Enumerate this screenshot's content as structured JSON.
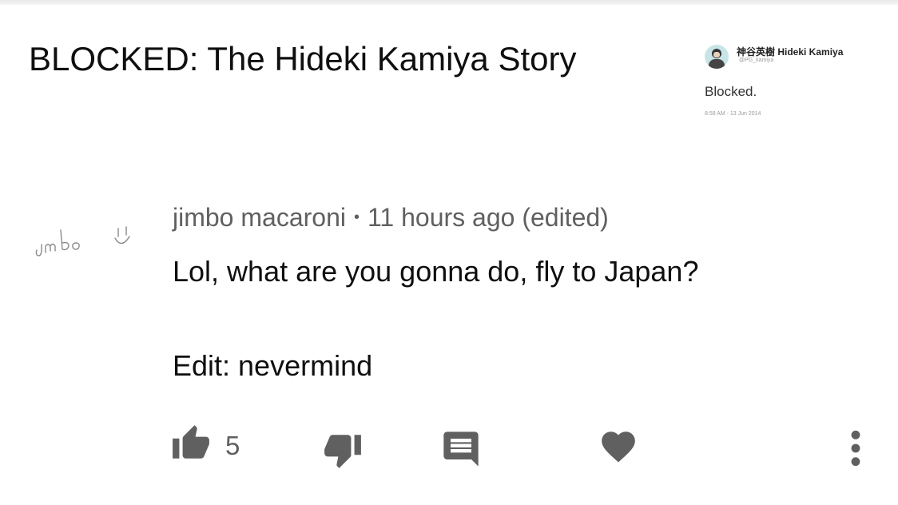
{
  "video": {
    "title": "BLOCKED: The Hideki Kamiya Story"
  },
  "tweet": {
    "display_name": "神谷英樹 Hideki Kamiya",
    "handle": "@PG_kamiya",
    "text": "Blocked.",
    "timestamp": "8:58 AM - 13 Jun 2014",
    "avatar_color": "#c7e4e6"
  },
  "comment": {
    "author_avatar_lettering": "jimbo :)",
    "author": "jimbo macaroni",
    "separator": "•",
    "time": "11 hours ago (edited)",
    "text": "Lol, what are you gonna do, fly to Japan?",
    "edit_note": "Edit: nevermind"
  },
  "actions": {
    "like_icon": "thumbs-up-icon",
    "like_count": "5",
    "dislike_icon": "thumbs-down-icon",
    "reply_icon": "comment-icon",
    "heart_icon": "heart-icon",
    "more_icon": "more-vertical-icon",
    "icon_color": "#606060"
  }
}
